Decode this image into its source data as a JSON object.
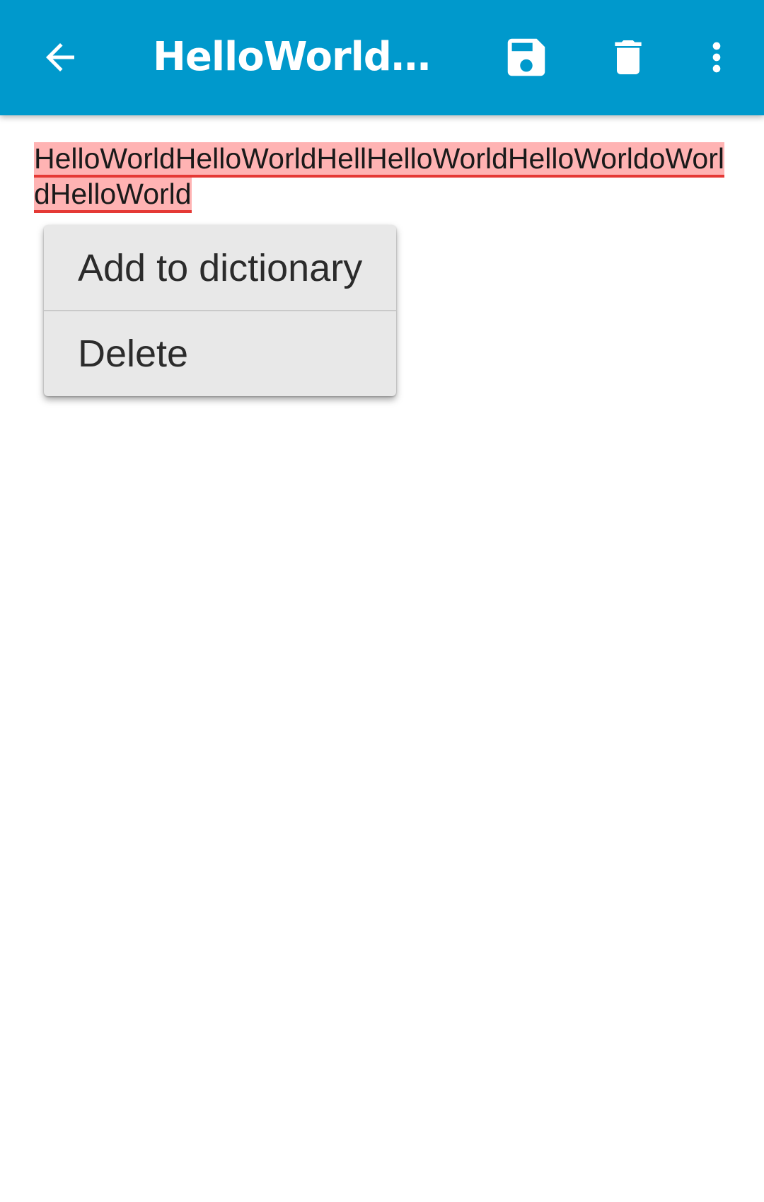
{
  "appbar": {
    "color": "#0099cc",
    "title": "HelloWorldHel…",
    "back_icon": "arrow-back-icon",
    "save_icon": "save-icon",
    "delete_icon": "trash-icon",
    "more_icon": "more-vert-icon"
  },
  "editor": {
    "text": "HelloWorldHelloWorldHellHelloWorldHelloWorldoWorldHelloWorld",
    "highlight_color": "#ffb3b3",
    "underline_color": "#e53935"
  },
  "spell_popup": {
    "items": [
      {
        "label": "Add to dictionary"
      },
      {
        "label": "Delete"
      }
    ]
  }
}
